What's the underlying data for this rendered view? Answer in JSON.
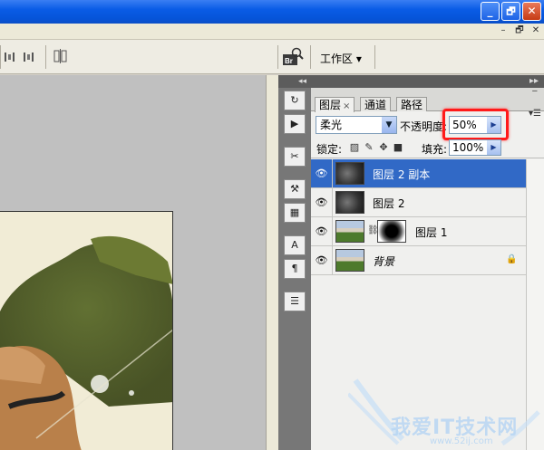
{
  "window": {
    "minimize": "_",
    "restore": "🗗",
    "close": "✕",
    "colors": {
      "titlebar": "#0a5ce6",
      "close": "#c63b14"
    }
  },
  "mdi": {
    "minimize": "–",
    "restore": "🗗",
    "close": "✕"
  },
  "options_bar": {
    "workspace_label": "工作区 ▾",
    "bridge_icon": "br-icon"
  },
  "dock": {
    "tools": [
      "history-icon",
      "actions-icon",
      "tool-presets-icon",
      "clone-source-icon",
      "layer-comps-icon",
      "character-icon",
      "paragraph-icon",
      "notes-icon"
    ]
  },
  "layers_panel": {
    "tabs": [
      {
        "label": "图层",
        "close": "×"
      },
      {
        "label": "通道"
      },
      {
        "label": "路径"
      }
    ],
    "blend_mode": "柔光",
    "opacity_label": "不透明度:",
    "opacity_value": "50%",
    "lock_label": "锁定:",
    "fill_label": "填充:",
    "fill_value": "100%",
    "layers": [
      {
        "name": "图层 2 副本",
        "selected": true
      },
      {
        "name": "图层 2"
      },
      {
        "name": "图层 1",
        "has_mask": true
      },
      {
        "name": "背景",
        "locked": true
      }
    ],
    "highlight_color": "#ff1a1a"
  },
  "watermark": {
    "text": "我爱IT技术网",
    "url": "www.52ij.com"
  }
}
